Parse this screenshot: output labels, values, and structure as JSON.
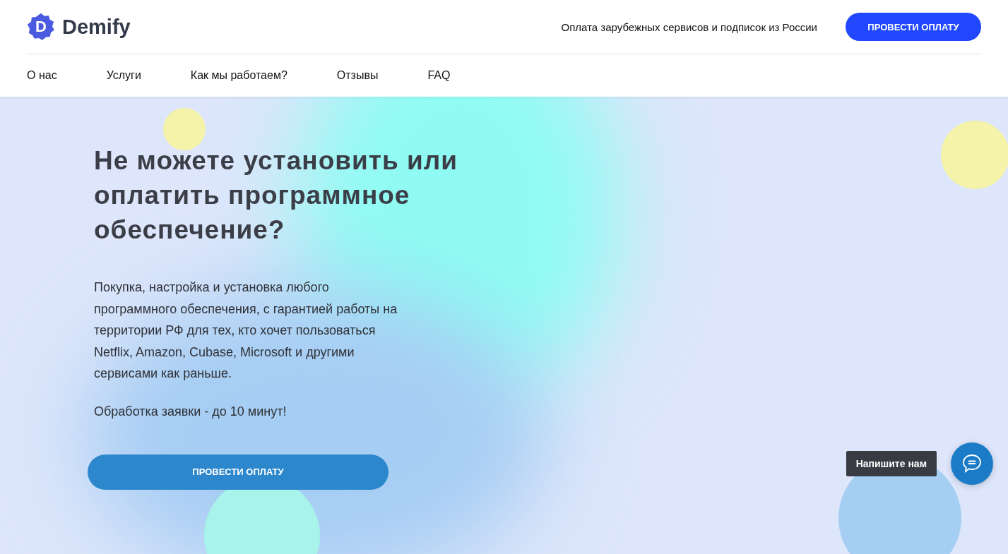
{
  "header": {
    "logo": {
      "mark": "D",
      "name": "Demify"
    },
    "tagline": "Оплата зарубежных сервисов и подписок из России",
    "cta": "ПРОВЕСТИ ОПЛАТУ"
  },
  "nav": [
    "О нас",
    "Услуги",
    "Как мы работаем?",
    "Отзывы",
    "FAQ"
  ],
  "hero": {
    "title": "Не можете установить или оплатить программное обеспечение?",
    "description": "Покупка, настройка и установка любого программного обеспечения, с гарантией работы на территории РФ для тех, кто хочет пользоваться Netflix, Amazon, Cubase, Microsoft и другими сервисами как раньше.",
    "note": "Обработка заявки - до 10 минут!",
    "cta": "ПРОВЕСТИ ОПЛАТУ"
  },
  "chat": {
    "tooltip": "Напишите нам"
  }
}
